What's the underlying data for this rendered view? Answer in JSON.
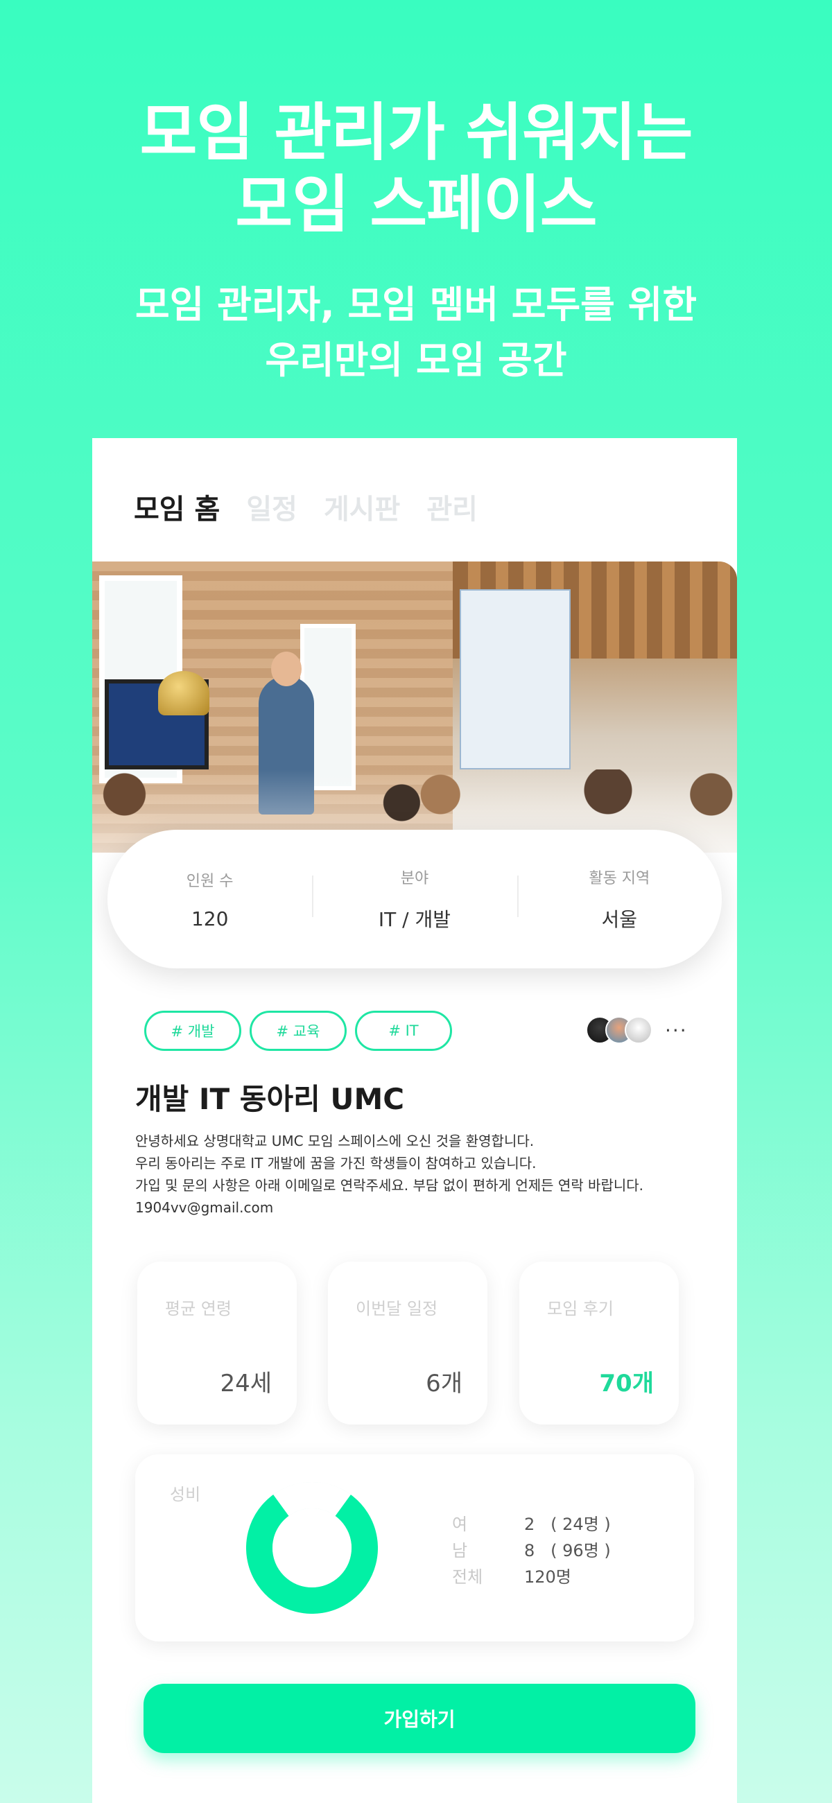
{
  "hero": {
    "title_line1": "모임 관리가 쉬워지는",
    "title_line2": "모임 스페이스",
    "subtitle_line1": "모임 관리자, 모임 멤버 모두를 위한",
    "subtitle_line2": "우리만의 모임 공간"
  },
  "tabs": [
    {
      "label": "모임 홈",
      "active": true
    },
    {
      "label": "일정",
      "active": false
    },
    {
      "label": "게시판",
      "active": false
    },
    {
      "label": "관리",
      "active": false
    }
  ],
  "stats": [
    {
      "label": "인원 수",
      "value": "120"
    },
    {
      "label": "분야",
      "value": "IT / 개발"
    },
    {
      "label": "활동 지역",
      "value": "서울"
    }
  ],
  "tags": [
    "# 개발",
    "# 교육",
    "# IT"
  ],
  "members": {
    "more_label": "···",
    "avatar_count": 3
  },
  "club": {
    "title": "개발 IT 동아리 UMC",
    "desc_line1": "안녕하세요 상명대학교 UMC 모임 스페이스에 오신 것을 환영합니다.",
    "desc_line2": "우리 동아리는 주로 IT 개발에 꿈을 가진 학생들이 참여하고 있습니다.",
    "desc_line3": "가입 및 문의 사항은 아래 이메일로 연락주세요. 부담 없이 편하게 언제든 연락 바랍니다.",
    "email": "1904vv@gmail.com"
  },
  "info_cards": [
    {
      "label": "평균 연령",
      "value": "24세"
    },
    {
      "label": "이번달 일정",
      "value": "6개"
    },
    {
      "label": "모임 후기",
      "value": "70개"
    }
  ],
  "gender": {
    "label": "성비",
    "rows": [
      {
        "key": "여",
        "value": "2   ( 24명 )"
      },
      {
        "key": "남",
        "value": "8   ( 96명 )"
      },
      {
        "key": "전체",
        "value": "120명"
      }
    ],
    "female_ratio": 0.2,
    "colors": {
      "male": "#02F0A5",
      "female": "#ffffff",
      "ring_bg": "#d8f7ec"
    }
  },
  "join_button": {
    "label": "가입하기"
  },
  "colors": {
    "accent": "#02F0A5",
    "tag": "#1fe6a4"
  }
}
